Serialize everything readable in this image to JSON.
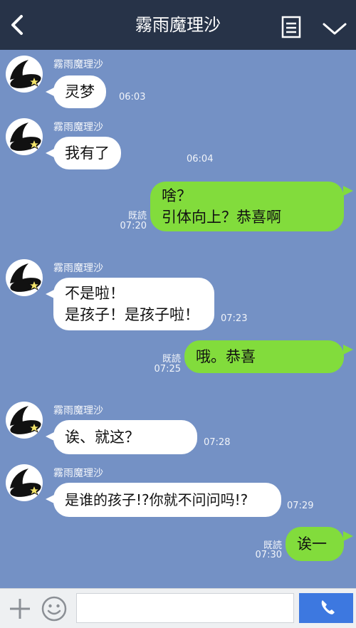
{
  "header": {
    "title": "霧雨魔理沙"
  },
  "messages": [
    {
      "sender": "霧雨魔理沙",
      "text": "灵梦",
      "time": "06:03"
    },
    {
      "sender": "霧雨魔理沙",
      "text": "我有了",
      "time": "06:04"
    },
    {
      "lines": [
        "啥？",
        "引体向上？恭喜啊"
      ],
      "read": "既読",
      "time": "07:20"
    },
    {
      "sender": "霧雨魔理沙",
      "lines": [
        "不是啦！",
        "是孩子！是孩子啦！"
      ],
      "time": "07:23"
    },
    {
      "text": "哦。恭喜",
      "read": "既読",
      "time": "07:25"
    },
    {
      "sender": "霧雨魔理沙",
      "text": "诶、就这？",
      "time": "07:28"
    },
    {
      "sender": "霧雨魔理沙",
      "text": "是谁的孩子!?你就不问问吗!?",
      "time": "07:29"
    },
    {
      "text": "诶一",
      "read": "既読",
      "time": "07:30"
    }
  ],
  "composer": {
    "placeholder": ""
  },
  "colors": {
    "background": "#7491c5",
    "header": "#273348",
    "bubble_self": "#82dc3c",
    "bubble_other": "#ffffff",
    "call_button": "#3d78e0"
  }
}
